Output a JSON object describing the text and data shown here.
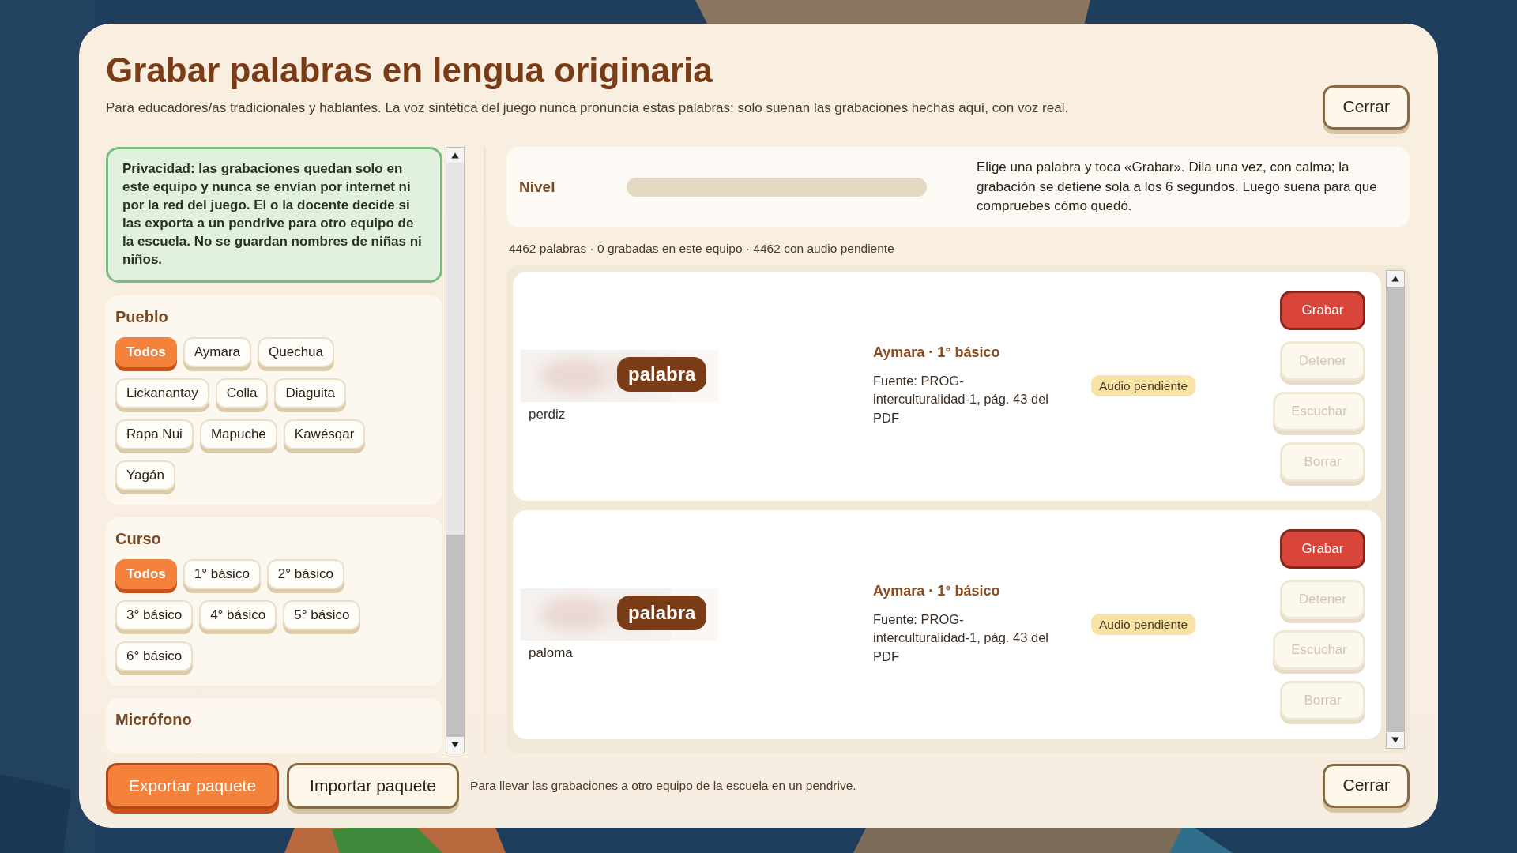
{
  "dialog": {
    "title": "Grabar palabras en lengua originaria",
    "subtitle": "Para educadores/as tradicionales y hablantes. La voz sintética del juego nunca pronuncia estas palabras: solo suenan las grabaciones hechas aquí, con voz real.",
    "close_button": "Cerrar"
  },
  "privacy_notice": "Privacidad: las grabaciones quedan solo en este equipo y nunca se envían por internet ni por la red del juego. El o la docente decide si las exporta a un pendrive para otro equipo de la escuela. No se guardan nombres de niñas ni niños.",
  "filters": [
    {
      "title": "Pueblo",
      "options": [
        {
          "label": "Todos",
          "selected": true
        },
        {
          "label": "Aymara",
          "selected": false
        },
        {
          "label": "Quechua",
          "selected": false
        },
        {
          "label": "Lickanantay",
          "selected": false
        },
        {
          "label": "Colla",
          "selected": false
        },
        {
          "label": "Diaguita",
          "selected": false
        },
        {
          "label": "Rapa Nui",
          "selected": false
        },
        {
          "label": "Mapuche",
          "selected": false
        },
        {
          "label": "Kawésqar",
          "selected": false
        },
        {
          "label": "Yagán",
          "selected": false
        }
      ]
    },
    {
      "title": "Curso",
      "options": [
        {
          "label": "Todos",
          "selected": true
        },
        {
          "label": "1° básico",
          "selected": false
        },
        {
          "label": "2° básico",
          "selected": false
        },
        {
          "label": "3° básico",
          "selected": false
        },
        {
          "label": "4° básico",
          "selected": false
        },
        {
          "label": "5° básico",
          "selected": false
        },
        {
          "label": "6° básico",
          "selected": false
        }
      ]
    },
    {
      "title": "Micrófono"
    }
  ],
  "level_meter": {
    "label": "Nivel",
    "level": 0
  },
  "instructions": "Elige una palabra y toca «Grabar». Dila una vez, con calma; la grabación se detiene sola a los 6 segundos. Luego suena para que compruebes cómo quedó.",
  "summary": "4462 palabras · 0 grabadas en este equipo · 4462 con audio pendiente",
  "words": [
    {
      "image_label": "palabra",
      "word": "perdiz",
      "category": "Aymara · 1° básico",
      "source": "Fuente: PROG-interculturalidad-1, pág. 43 del PDF",
      "status": "Audio pendiente",
      "actions": [
        {
          "label": "Grabar",
          "kind": "record",
          "disabled": false
        },
        {
          "label": "Detener",
          "kind": "stop",
          "disabled": true
        },
        {
          "label": "Escuchar",
          "kind": "play",
          "disabled": true
        },
        {
          "label": "Borrar",
          "kind": "delete",
          "disabled": true
        }
      ]
    },
    {
      "image_label": "palabra",
      "word": "paloma",
      "category": "Aymara · 1° básico",
      "source": "Fuente: PROG-interculturalidad-1, pág. 43 del PDF",
      "status": "Audio pendiente",
      "actions": [
        {
          "label": "Grabar",
          "kind": "record",
          "disabled": false
        },
        {
          "label": "Detener",
          "kind": "stop",
          "disabled": true
        },
        {
          "label": "Escuchar",
          "kind": "play",
          "disabled": true
        },
        {
          "label": "Borrar",
          "kind": "delete",
          "disabled": true
        }
      ]
    }
  ],
  "footer": {
    "buttons": [
      {
        "label": "Exportar paquete",
        "kind": "primary"
      },
      {
        "label": "Importar paquete",
        "kind": "secondary"
      }
    ],
    "note": "Para llevar las grabaciones a otro equipo de la escuela en un pendrive.",
    "close_button": "Cerrar"
  }
}
